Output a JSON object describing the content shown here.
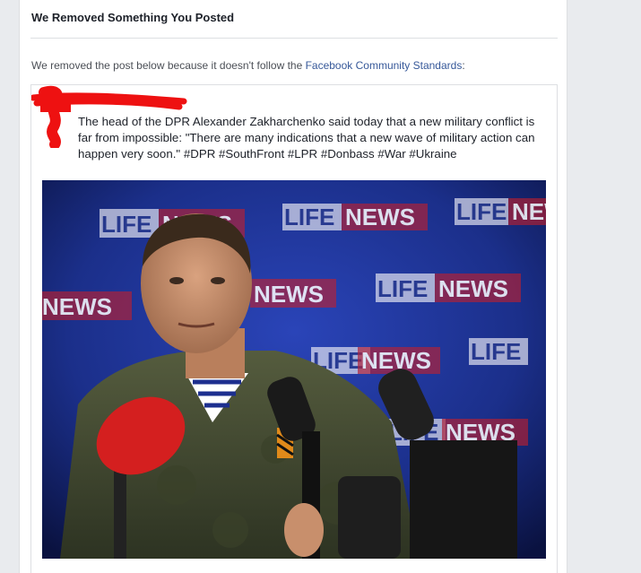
{
  "removal_notice": {
    "title": "We Removed Something You Posted",
    "message_prefix": "We removed the post below because it doesn't follow the ",
    "link_text": "Facebook Community Standards",
    "message_suffix": ":"
  },
  "post": {
    "text": "The head of the DPR Alexander Zakharchenko said today that a new military conflict is far from impossible: \"There are many indications that a new wave of military action can happen very soon.\" #DPR #SouthFront #LPR #Donbass #War #Ukraine",
    "photo": {
      "backdrop_logo_text_left": "LIFE",
      "backdrop_logo_text_right": "NEWS"
    }
  },
  "colors": {
    "link": "#365899",
    "redaction": "#ee1111",
    "backdrop_blue": "#1b2f8a",
    "uniform_green": "#4a5236",
    "mic_red": "#d41f1f"
  }
}
